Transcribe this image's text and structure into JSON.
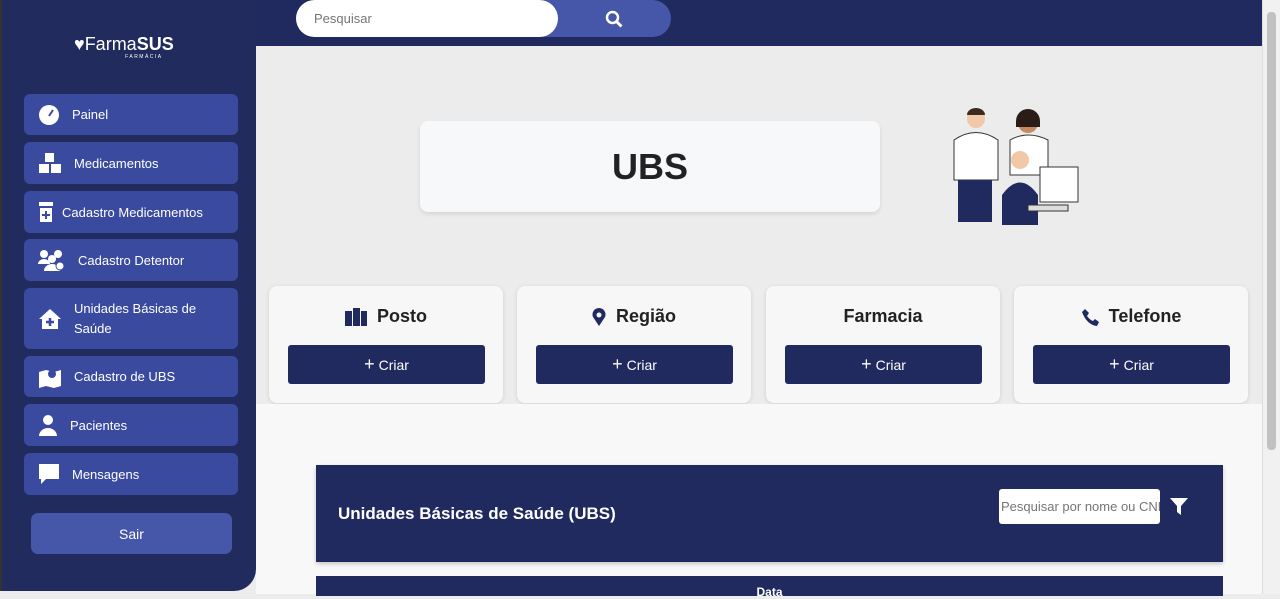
{
  "sidebar": {
    "logo": {
      "name": "Farma",
      "brand": "SUS",
      "sub": "FARMÁCIA"
    },
    "items": [
      {
        "label": "Painel",
        "icon": "gauge-icon"
      },
      {
        "label": "Medicamentos",
        "icon": "boxes-icon"
      },
      {
        "label": "Cadastro Medicamentos",
        "icon": "prescription-bottle-icon"
      },
      {
        "label": "Cadastro Detentor",
        "icon": "users-gear-icon"
      },
      {
        "label": "Unidades Básicas de Saúde",
        "icon": "house-medical-icon"
      },
      {
        "label": "Cadastro de UBS",
        "icon": "map-location-icon"
      },
      {
        "label": "Pacientes",
        "icon": "user-doctor-icon"
      },
      {
        "label": "Mensagens",
        "icon": "message-icon"
      }
    ],
    "logout": "Sair"
  },
  "topbar": {
    "search_placeholder": "Pesquisar"
  },
  "page": {
    "title": "UBS"
  },
  "cards": [
    {
      "title": "Posto",
      "button": "Criar"
    },
    {
      "title": "Região",
      "button": "Criar"
    },
    {
      "title": "Farmacia",
      "button": "Criar"
    },
    {
      "title": "Telefone",
      "button": "Criar"
    }
  ],
  "ubs": {
    "title": "Unidades Básicas de Saúde (UBS)",
    "search_placeholder": "Pesquisar por nome ou CNES",
    "table_header": "Data"
  },
  "colors": {
    "navy": "#202a5e",
    "nav_item": "#3a4a9f"
  }
}
